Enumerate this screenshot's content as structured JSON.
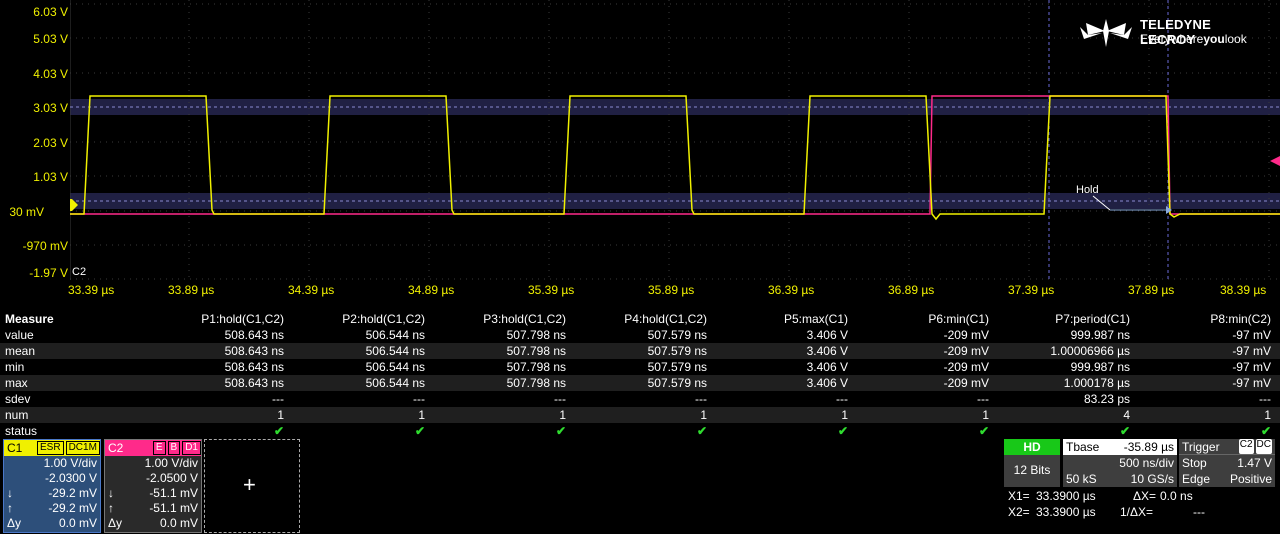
{
  "colors": {
    "c1": "#f0f000",
    "c2": "#ff2a8a",
    "accent_hd": "#18c818"
  },
  "y_axis": [
    "6.03 V",
    "5.03 V",
    "4.03 V",
    "3.03 V",
    "2.03 V",
    "1.03 V",
    "30 mV",
    "-970 mV",
    "-1.97 V"
  ],
  "x_axis": [
    "33.39 µs",
    "33.89 µs",
    "34.39 µs",
    "34.89 µs",
    "35.39 µs",
    "35.89 µs",
    "36.39 µs",
    "36.89 µs",
    "37.39 µs",
    "37.89 µs",
    "38.39 µs"
  ],
  "logo": {
    "brand": "TELEDYNE LECROY",
    "tagline_pre": "Everywhere",
    "tagline_bold": "you",
    "tagline_post": "look",
    "icon": "teledyne-logo-icon"
  },
  "markers": {
    "c1": "C1",
    "c2": "C2",
    "hold": "Hold"
  },
  "measure": {
    "header_label": "Measure",
    "columns": [
      "P1:hold(C1,C2)",
      "P2:hold(C1,C2)",
      "P3:hold(C1,C2)",
      "P4:hold(C1,C2)",
      "P5:max(C1)",
      "P6:min(C1)",
      "P7:period(C1)",
      "P8:min(C2)"
    ],
    "rows": [
      {
        "label": "value",
        "cells": [
          "508.643 ns",
          "506.544 ns",
          "507.798 ns",
          "507.579 ns",
          "3.406 V",
          "-209 mV",
          "999.987 ns",
          "-97 mV"
        ]
      },
      {
        "label": "mean",
        "cells": [
          "508.643 ns",
          "506.544 ns",
          "507.798 ns",
          "507.579 ns",
          "3.406 V",
          "-209 mV",
          "1.00006966 µs",
          "-97 mV"
        ]
      },
      {
        "label": "min",
        "cells": [
          "508.643 ns",
          "506.544 ns",
          "507.798 ns",
          "507.579 ns",
          "3.406 V",
          "-209 mV",
          "999.987 ns",
          "-97 mV"
        ]
      },
      {
        "label": "max",
        "cells": [
          "508.643 ns",
          "506.544 ns",
          "507.798 ns",
          "507.579 ns",
          "3.406 V",
          "-209 mV",
          "1.000178 µs",
          "-97 mV"
        ]
      },
      {
        "label": "sdev",
        "cells": [
          "---",
          "---",
          "---",
          "---",
          "---",
          "---",
          "83.23 ps",
          "---"
        ]
      },
      {
        "label": "num",
        "cells": [
          "1",
          "1",
          "1",
          "1",
          "1",
          "1",
          "4",
          "1"
        ]
      },
      {
        "label": "status",
        "cells": [
          "✔",
          "✔",
          "✔",
          "✔",
          "✔",
          "✔",
          "✔",
          "✔"
        ]
      }
    ]
  },
  "ch1": {
    "name": "C1",
    "tags": [
      "ESR",
      "DC1M"
    ],
    "vdiv": "1.00 V/div",
    "offset": "-2.0300 V",
    "down_k": "↓",
    "down": "-29.2 mV",
    "up_k": "↑",
    "up": "-29.2 mV",
    "dy_k": "Δy",
    "dy": "0.0 mV"
  },
  "ch2": {
    "name": "C2",
    "tags": [
      "E",
      "B",
      "D1"
    ],
    "vdiv": "1.00 V/div",
    "offset": "-2.0500 V",
    "down_k": "↓",
    "down": "-51.1 mV",
    "up_k": "↑",
    "up": "-51.1 mV",
    "dy_k": "Δy",
    "dy": "0.0 mV"
  },
  "math_slot": {
    "plus": "+"
  },
  "hd": {
    "label": "HD",
    "bits": "12 Bits"
  },
  "timebase": {
    "label": "Tbase",
    "delay": "-35.89 µs",
    "tdiv": "500 ns/div",
    "samples": "50 kS",
    "rate": "10 GS/s"
  },
  "trigger": {
    "label": "Trigger",
    "src": "C2",
    "coupling": "DC",
    "mode": "Stop",
    "level": "1.47 V",
    "type": "Edge",
    "slope": "Positive"
  },
  "cursors": {
    "x1_k": "X1=",
    "x1": "33.3900 µs",
    "dx_k": "ΔX=",
    "dx": "0.0 ns",
    "x2_k": "X2=",
    "x2": "33.3900 µs",
    "idx_k": "1/ΔX=",
    "idx": "---"
  }
}
